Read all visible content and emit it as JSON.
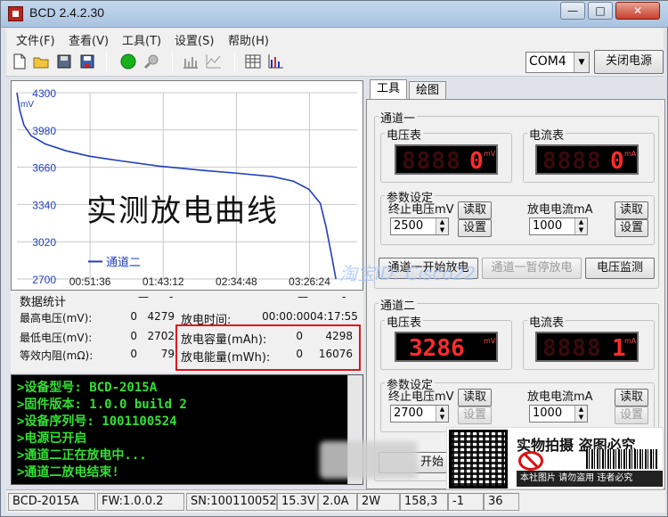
{
  "window": {
    "title": "BCD 2.4.2.30",
    "minimize_icon": "minimize-icon",
    "maximize_icon": "maximize-icon",
    "close_icon": "close-icon"
  },
  "menu": [
    "文件(F)",
    "查看(V)",
    "工具(T)",
    "设置(S)",
    "帮助(H)"
  ],
  "toolbar": {
    "icons": [
      "new-file-icon",
      "open-folder-icon",
      "save-disk-icon",
      "save-as-icon",
      "connect-green-icon",
      "search-icon",
      "chart-bars-icon",
      "chart-line-icon",
      "table-icon",
      "chart-bars-color-icon"
    ],
    "port_value": "COM4",
    "close_power_label": "关闭电源"
  },
  "chart_data": {
    "type": "line",
    "series": [
      {
        "name": "通道二",
        "color": "#1f3fbf",
        "x": [
          0,
          2,
          5,
          10,
          20,
          35,
          51,
          70,
          100,
          134,
          154,
          180,
          195,
          206,
          214,
          218,
          222,
          225
        ],
        "y": [
          4300,
          4150,
          4020,
          3930,
          3860,
          3800,
          3755,
          3720,
          3670,
          3630,
          3610,
          3580,
          3540,
          3470,
          3350,
          3150,
          2900,
          2700
        ]
      }
    ],
    "xlabel": "",
    "ylabel": "mV",
    "xticks": [
      "00:51:36",
      "01:43:12",
      "02:34:48",
      "03:26:24"
    ],
    "xtick_minutes": [
      51.6,
      103.2,
      154.8,
      206.4
    ],
    "xlim": [
      0,
      240
    ],
    "yticks": [
      4300,
      3980,
      3660,
      3340,
      3020,
      2700
    ],
    "ylim": [
      2700,
      4300
    ],
    "overlay_text": "实测放电曲线",
    "grid": true
  },
  "stats": {
    "header": "数据统计",
    "rows": [
      {
        "label": "最高电压(mV):",
        "a": "0",
        "b": "4279"
      },
      {
        "label": "最低电压(mV):",
        "a": "0",
        "b": "2702"
      },
      {
        "label": "等效内阻(mΩ):",
        "a": "0",
        "b": "79"
      }
    ],
    "right": [
      {
        "label": "放电时间:",
        "a": "00:00:00",
        "b": "04:17:55"
      },
      {
        "label": "放电容量(mAh):",
        "a": "0",
        "b": "4298"
      },
      {
        "label": "放电能量(mWh):",
        "a": "0",
        "b": "16076"
      }
    ]
  },
  "log": [
    ">设备型号: BCD-2015A",
    ">固件版本: 1.0.0 build 2",
    ">设备序列号: 1001100524",
    ">电源已开启",
    ">通道二正在放电中...",
    ">通道二放电结束!"
  ],
  "tabs": [
    "工具",
    "绘图"
  ],
  "ch1": {
    "title": "通道一",
    "voltmeter": "电压表",
    "ammeter": "电流表",
    "volt_value": "0",
    "volt_unit": "mV",
    "amp_value": "0",
    "amp_unit": "mA",
    "params_title": "参数设定",
    "cutoff_label": "终止电压mV",
    "cutoff_value": "2500",
    "current_label": "放电电流mA",
    "current_value": "1000",
    "read": "读取",
    "set": "设置",
    "start": "通道一开始放电",
    "pause": "通道一暂停放电",
    "monitor": "电压监测"
  },
  "ch2": {
    "title": "通道二",
    "voltmeter": "电压表",
    "ammeter": "电流表",
    "volt_value": "3286",
    "volt_unit": "mV",
    "amp_value": "1",
    "amp_unit": "mA",
    "params_title": "参数设定",
    "cutoff_label": "终止电压mV",
    "cutoff_value": "2700",
    "current_label": "放电电流mA",
    "current_value": "1000",
    "read": "读取",
    "set": "设置",
    "start_partial": "开始"
  },
  "status": [
    "BCD-2015A",
    "FW:1.0.0.2",
    "SN:100110052",
    "15.3V",
    "2.0A",
    "2W",
    "158,3",
    "-1",
    "36"
  ],
  "watermark": "淘宝ID: Cisco22",
  "ad": {
    "title": "实物拍摄 盗图必究",
    "bar": "本社图片 请勿盗用 违者必究"
  }
}
